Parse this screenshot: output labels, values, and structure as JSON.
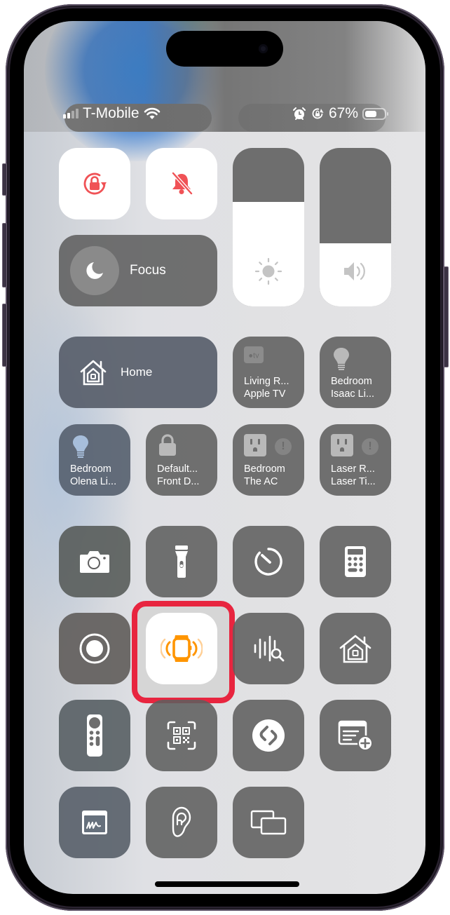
{
  "status_bar": {
    "carrier": "T-Mobile",
    "signal_bars_active": 2,
    "signal_bars_total": 4,
    "wifi_icon": "wifi-icon",
    "alarm_icon": "alarm-clock-icon",
    "rotation_lock_icon": "rotation-lock-icon",
    "battery_percent": "67%",
    "battery_level": 0.67
  },
  "connectivity": {
    "orientation_lock": {
      "icon": "orientation-lock-icon",
      "state": "on"
    },
    "silent_mode": {
      "icon": "bell-slash-icon",
      "state": "on"
    },
    "accent_color": "#f05256"
  },
  "focus": {
    "label": "Focus",
    "icon": "moon-icon"
  },
  "sliders": {
    "brightness": {
      "icon": "sun-icon",
      "level_percent": 66
    },
    "volume": {
      "icon": "speaker-icon",
      "level_percent": 40
    }
  },
  "home": {
    "label": "Home",
    "accessories": [
      {
        "line1": "Living R...",
        "line2": "Apple TV",
        "icon": "apple-tv-icon"
      },
      {
        "line1": "Bedroom",
        "line2": "Isaac Li...",
        "icon": "lightbulb-icon"
      },
      {
        "line1": "Bedroom",
        "line2": "Olena Li...",
        "icon": "lightbulb-icon"
      },
      {
        "line1": "Default...",
        "line2": "Front D...",
        "icon": "lock-icon"
      },
      {
        "line1": "Bedroom",
        "line2": "The AC",
        "icon": "outlet-icon",
        "alert": "!"
      },
      {
        "line1": "Laser R...",
        "line2": "Laser Ti...",
        "icon": "outlet-icon",
        "alert": "!"
      }
    ]
  },
  "controls": [
    {
      "name": "camera",
      "icon": "camera-icon"
    },
    {
      "name": "flashlight",
      "icon": "flashlight-icon"
    },
    {
      "name": "timer",
      "icon": "timer-icon"
    },
    {
      "name": "calculator",
      "icon": "calculator-icon"
    },
    {
      "name": "screen-recording",
      "icon": "record-icon"
    },
    {
      "name": "ping-my-watch",
      "icon": "watch-ping-icon",
      "highlighted": true,
      "accent_color": "#ff9500"
    },
    {
      "name": "music-recognition-sound",
      "icon": "waveform-search-icon"
    },
    {
      "name": "home",
      "icon": "home-icon"
    },
    {
      "name": "apple-tv-remote",
      "icon": "tv-remote-icon"
    },
    {
      "name": "code-scanner",
      "icon": "qr-code-icon"
    },
    {
      "name": "shazam",
      "icon": "shazam-icon"
    },
    {
      "name": "quick-note",
      "icon": "quick-note-icon"
    },
    {
      "name": "notes-signature",
      "icon": "signature-icon"
    },
    {
      "name": "hearing",
      "icon": "ear-icon"
    },
    {
      "name": "screen-mirroring",
      "icon": "screen-mirroring-icon"
    }
  ],
  "highlight_color": "#e8253f"
}
